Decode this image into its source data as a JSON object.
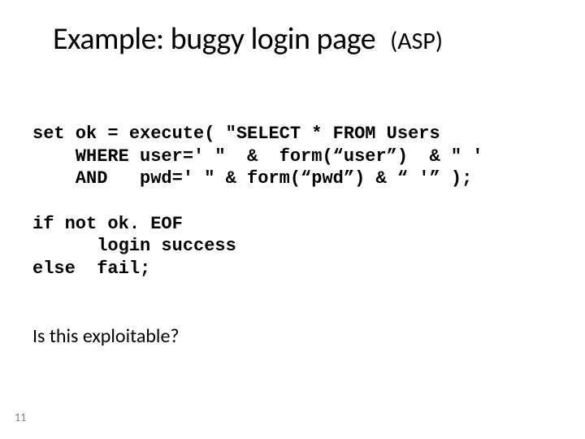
{
  "title": "Example:  buggy login page",
  "subtitle": "(ASP)",
  "code": {
    "line1": "set ok = execute( \"SELECT * FROM Users",
    "line2": "    WHERE user=' \"  &  form(“user”)  & \" '",
    "line3": "    AND   pwd=' \" & form(“pwd”) & “ '” );",
    "line4": "if not ok. EOF",
    "line5": "      login success",
    "line6": "else  fail;"
  },
  "question": "Is this exploitable?",
  "page_number": "11"
}
